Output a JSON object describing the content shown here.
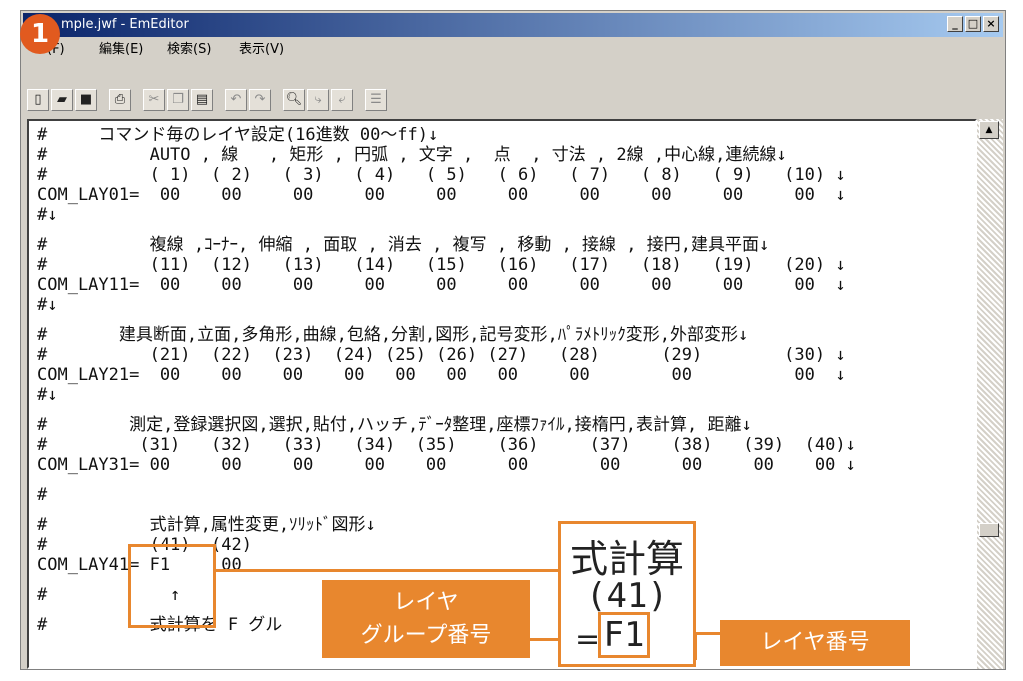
{
  "window": {
    "title": "mple.jwf - EmEditor",
    "controls": {
      "minimize": "_",
      "maximize": "□",
      "close": "×"
    }
  },
  "badge": {
    "number": "1"
  },
  "menu": [
    {
      "label": "(F)"
    },
    {
      "label": "編集(E)"
    },
    {
      "label": "検索(S)"
    },
    {
      "label": "表示(V)"
    }
  ],
  "toolbar": {
    "icons": [
      "new-file-icon",
      "open-folder-icon",
      "save-icon",
      "print-icon",
      "cut-icon",
      "copy-icon",
      "paste-icon",
      "undo-icon",
      "redo-icon",
      "find-icon",
      "find-next-icon",
      "find-prev-icon",
      "list-icon"
    ]
  },
  "editor": {
    "lines": [
      "#     コマンド毎のレイヤ設定(16進数 00〜ff)↓",
      "#          AUTO , 線   , 矩形 , 円弧 , 文字 ,  点  , 寸法 , 2線 ,中心線,連続線↓",
      "#          ( 1)  ( 2)   ( 3)   ( 4)   ( 5)   ( 6)   ( 7)   ( 8)   ( 9)   (10) ↓",
      "COM_LAY01=  00    00     00     00     00     00     00     00     00     00  ↓",
      "#↓",
      "#          複線 ,ｺｰﾅｰ, 伸縮 , 面取 , 消去 , 複写 , 移動 , 接線 , 接円,建具平面↓",
      "#          (11)  (12)   (13)   (14)   (15)   (16)   (17)   (18)   (19)   (20) ↓",
      "COM_LAY11=  00    00     00     00     00     00     00     00     00     00  ↓",
      "#↓",
      "#       建具断面,立面,多角形,曲線,包絡,分割,図形,記号変形,ﾊﾟﾗﾒﾄﾘｯｸ変形,外部変形↓",
      "#          (21)  (22)  (23)  (24) (25) (26) (27)   (28)      (29)        (30) ↓",
      "COM_LAY21=  00    00    00    00   00   00   00     00        00          00  ↓",
      "#↓",
      "#        測定,登録選択図,選択,貼付,ハッチ,ﾃﾞｰﾀ整理,座標ﾌｧｲﾙ,接楕円,表計算, 距離↓",
      "#         (31)   (32)   (33)   (34)  (35)    (36)     (37)    (38)   (39)  (40)↓",
      "COM_LAY31= 00     00     00     00    00      00       00      00     00    00 ↓",
      "#",
      "#          式計算,属性変更,ｿﾘｯﾄﾞ図形↓",
      "#          (41)  (42)",
      "COM_LAY41= F1     00",
      "#            ↑",
      "#          式計算を F グル"
    ]
  },
  "callouts": {
    "zoom_title": "式計算",
    "zoom_number": "(41)",
    "zoom_equals": "=",
    "zoom_value": "F1",
    "group_label": "レイヤ\nグループ番号",
    "layer_label": "レイヤ番号"
  },
  "colors": {
    "accent": "#e8872e",
    "badge": "#e15a1f"
  }
}
